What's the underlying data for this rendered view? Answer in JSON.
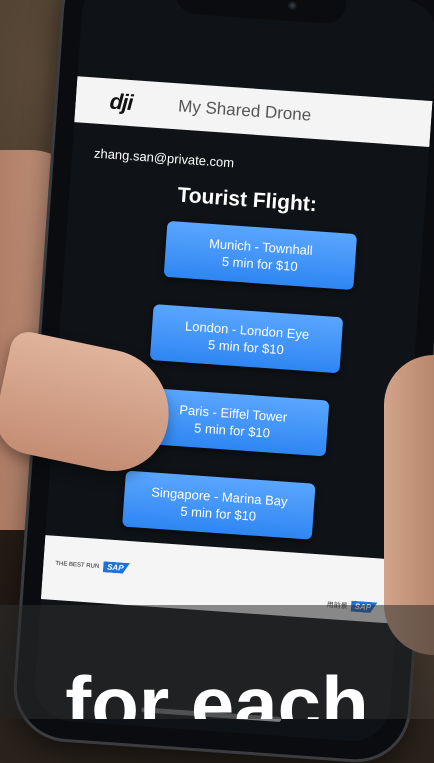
{
  "app": {
    "logo": "dji",
    "title": "My Shared Drone",
    "user_email": "zhang.san@private.com",
    "section_title": "Tourist Flight:"
  },
  "flights": [
    {
      "destination": "Munich - Townhall",
      "price": "5 min for $10"
    },
    {
      "destination": "London - London Eye",
      "price": "5 min for $10"
    },
    {
      "destination": "Paris - Eiffel Tower",
      "price": "5 min for $10"
    },
    {
      "destination": "Singapore - Marina Bay",
      "price": "5 min for $10"
    }
  ],
  "footer": {
    "left_text": "THE BEST RUN",
    "left_logo": "SAP",
    "right_text": "用前景",
    "right_logo": "SAP"
  },
  "caption": "for each",
  "colors": {
    "button": "#2f86f2",
    "header_bg": "#f4f4f4",
    "screen_bg": "#0f1216"
  }
}
